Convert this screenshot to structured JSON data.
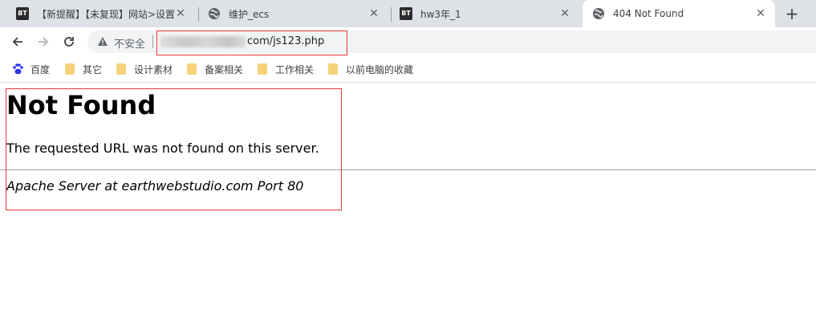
{
  "tabs": [
    {
      "title": "【新提醒】【未复现】网站>设置",
      "icon": "bt-icon"
    },
    {
      "title": "维护_ecs",
      "icon": "globe-icon"
    },
    {
      "title": "hw3年_1",
      "icon": "bt-icon"
    },
    {
      "title": "404 Not Found",
      "icon": "globe-icon",
      "active": true
    }
  ],
  "toolbar": {
    "security_label": "不安全",
    "url_visible": "com/js123.php"
  },
  "bookmarks": [
    {
      "label": "百度",
      "icon": "baidu-paw-icon"
    },
    {
      "label": "其它",
      "icon": "folder-icon"
    },
    {
      "label": "设计素材",
      "icon": "folder-icon"
    },
    {
      "label": "备案相关",
      "icon": "folder-icon"
    },
    {
      "label": "工作相关",
      "icon": "folder-icon"
    },
    {
      "label": "以前电脑的收藏",
      "icon": "folder-icon"
    }
  ],
  "page": {
    "heading": "Not Found",
    "message": "The requested URL was not found on this server.",
    "address": "Apache Server at earthwebstudio.com Port 80"
  },
  "colors": {
    "tabstrip_bg": "#dee1e6",
    "omnibox_bg": "#f1f3f4",
    "highlight_red": "#e53935",
    "folder_yellow": "#f6d27a",
    "baidu_blue": "#2932e1"
  }
}
